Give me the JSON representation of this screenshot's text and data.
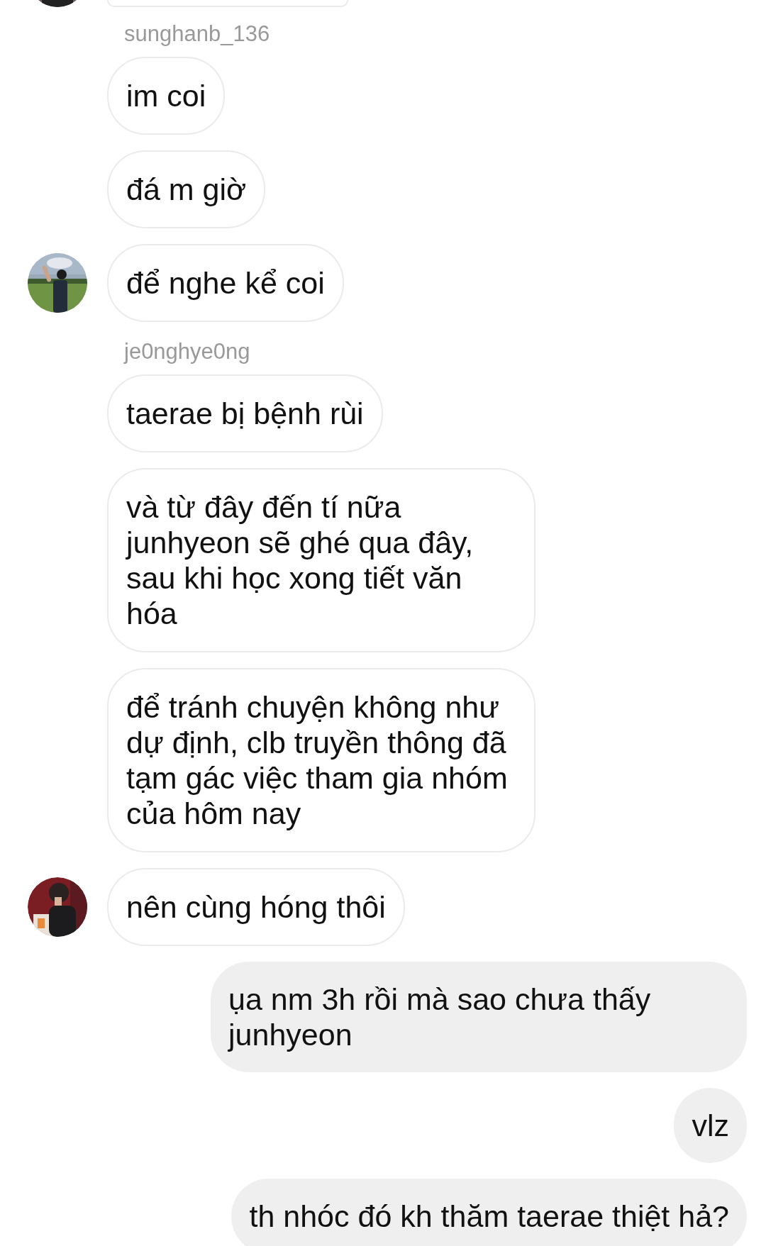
{
  "messages": [
    {
      "kind": "cut_off_incoming",
      "avatar": true
    },
    {
      "kind": "username",
      "text": "sunghanb_136"
    },
    {
      "kind": "incoming",
      "text": "im coi",
      "avatar": false
    },
    {
      "kind": "incoming",
      "text": "đá m giờ",
      "avatar": false
    },
    {
      "kind": "incoming",
      "text": "để nghe kể coi",
      "avatar": true
    },
    {
      "kind": "username",
      "text": "je0nghye0ng"
    },
    {
      "kind": "incoming",
      "text": "taerae bị bệnh rùi",
      "avatar": false
    },
    {
      "kind": "incoming",
      "text": "và từ đây đến tí nữa junhyeon sẽ ghé qua đây, sau khi học xong tiết văn hóa",
      "avatar": false
    },
    {
      "kind": "incoming",
      "text": "để tránh chuyện không như dự định, clb truyền thông đã tạm gác việc tham gia nhóm của hôm nay",
      "avatar": false
    },
    {
      "kind": "incoming",
      "text": "nên cùng hóng thôi",
      "avatar": true
    },
    {
      "kind": "outgoing",
      "text": "ụa nm 3h rồi mà sao chưa thấy junhyeon"
    },
    {
      "kind": "outgoing",
      "text": "vlz"
    },
    {
      "kind": "outgoing",
      "text": "th nhóc đó kh thăm taerae thiệt hả?"
    }
  ]
}
